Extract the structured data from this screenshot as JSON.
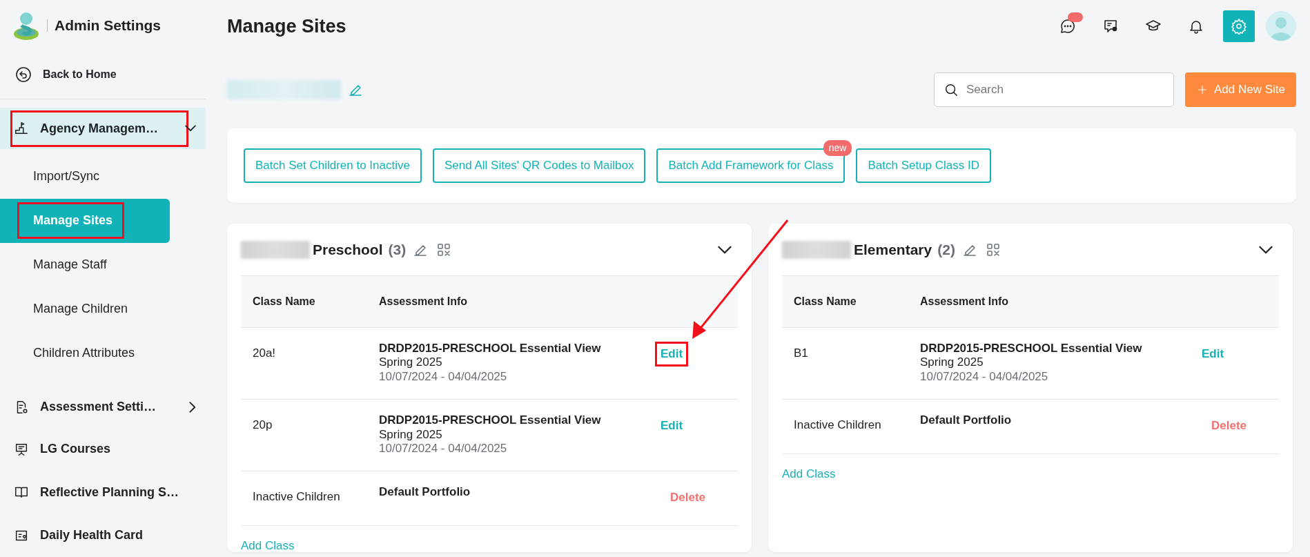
{
  "app": {
    "section_title": "Admin Settings"
  },
  "sidebar": {
    "back_link": "Back to Home",
    "items": [
      {
        "label": "Agency Managem…",
        "kind": "group",
        "expanded": true,
        "highlighted": true,
        "children": [
          {
            "label": "Import/Sync",
            "selected": false,
            "highlighted": false
          },
          {
            "label": "Manage Sites",
            "selected": true,
            "highlighted": true
          },
          {
            "label": "Manage Staff",
            "selected": false,
            "highlighted": false
          },
          {
            "label": "Manage Children",
            "selected": false,
            "highlighted": false
          },
          {
            "label": "Children Attributes",
            "selected": false,
            "highlighted": false
          }
        ]
      },
      {
        "label": "Assessment Setti…",
        "kind": "group",
        "expanded": false,
        "highlighted": false
      },
      {
        "label": "LG Courses",
        "kind": "link"
      },
      {
        "label": "Reflective Planning S…",
        "kind": "link"
      },
      {
        "label": "Daily Health Card",
        "kind": "link"
      }
    ]
  },
  "page": {
    "title": "Manage Sites",
    "search": {
      "placeholder": "Search"
    },
    "add_button": "Add New Site"
  },
  "batch_actions": [
    {
      "label": "Batch Set Children to Inactive"
    },
    {
      "label": "Send All Sites' QR Codes to Mailbox"
    },
    {
      "label": "Batch Add Framework for Class",
      "badge": "new"
    },
    {
      "label": "Batch Setup Class ID"
    }
  ],
  "sites": [
    {
      "name": "Preschool",
      "count": "(3)",
      "expanded": true,
      "columns": [
        "Class Name",
        "Assessment Info"
      ],
      "rows": [
        {
          "class_name": "20a!",
          "framework": "DRDP2015-PRESCHOOL Essential View",
          "term": "Spring 2025",
          "dates": "10/07/2024 - 04/04/2025",
          "action": {
            "label": "Edit",
            "kind": "edit",
            "highlighted": true
          }
        },
        {
          "class_name": "20p",
          "framework": "DRDP2015-PRESCHOOL Essential View",
          "term": "Spring 2025",
          "dates": "10/07/2024 - 04/04/2025",
          "action": {
            "label": "Edit",
            "kind": "edit",
            "highlighted": false
          }
        },
        {
          "class_name": "Inactive Children",
          "framework": "Default Portfolio",
          "action": {
            "label": "Delete",
            "kind": "delete",
            "highlighted": false
          }
        }
      ],
      "add_link": "Add Class"
    },
    {
      "name": "Elementary",
      "count": "(2)",
      "expanded": true,
      "columns": [
        "Class Name",
        "Assessment Info"
      ],
      "rows": [
        {
          "class_name": "B1",
          "framework": "DRDP2015-PRESCHOOL Essential View",
          "term": "Spring 2025",
          "dates": "10/07/2024 - 04/04/2025",
          "action": {
            "label": "Edit",
            "kind": "edit",
            "highlighted": false
          }
        },
        {
          "class_name": "Inactive Children",
          "framework": "Default Portfolio",
          "action": {
            "label": "Delete",
            "kind": "delete",
            "highlighted": false
          }
        }
      ],
      "add_link": "Add Class"
    }
  ]
}
